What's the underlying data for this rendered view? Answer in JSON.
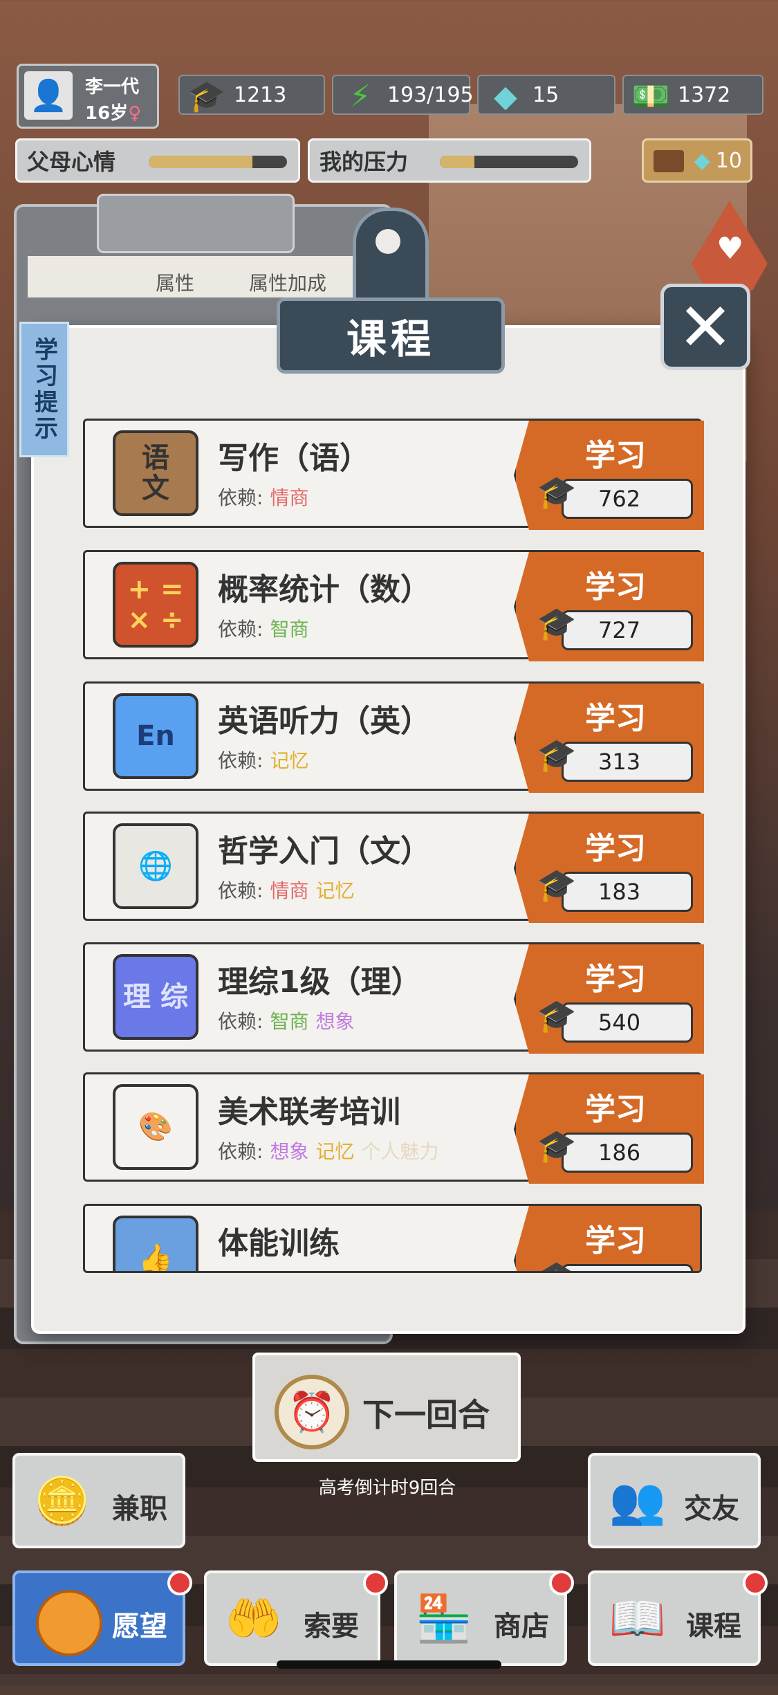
{
  "player": {
    "name": "李一代",
    "age": "16岁",
    "gender_symbol": "♀"
  },
  "stats": [
    {
      "icon": "graduation-cap-icon",
      "value": "1213"
    },
    {
      "icon": "lightning-icon",
      "value": "193/195"
    },
    {
      "icon": "diamond-icon",
      "value": "15"
    },
    {
      "icon": "money-icon",
      "value": "1372"
    }
  ],
  "moods": [
    {
      "label": "父母心情",
      "fill": 0.75
    },
    {
      "label": "我的压力",
      "fill": 0.25
    }
  ],
  "video_reward": {
    "value": "10"
  },
  "clipboard": {
    "col1": "属性",
    "col2": "属性加成",
    "tip_tab": "学习提示"
  },
  "panel": {
    "title": "课程"
  },
  "courses": [
    {
      "icon": "语\n文",
      "name": "写作（语）",
      "dep_label": "依赖:",
      "deps": [
        {
          "t": "情商",
          "c": "#e26a6a"
        }
      ],
      "btn": "学习",
      "cost": "762"
    },
    {
      "icon": "+ =\n× ÷",
      "name": "概率统计（数）",
      "dep_label": "依赖:",
      "deps": [
        {
          "t": "智商",
          "c": "#6db34f"
        }
      ],
      "btn": "学习",
      "cost": "727"
    },
    {
      "icon": "En",
      "name": "英语听力（英）",
      "dep_label": "依赖:",
      "deps": [
        {
          "t": "记忆",
          "c": "#e0b030"
        }
      ],
      "btn": "学习",
      "cost": "313"
    },
    {
      "icon": "🌐",
      "name": "哲学入门（文）",
      "dep_label": "依赖:",
      "deps": [
        {
          "t": "情商",
          "c": "#e26a6a"
        },
        {
          "t": "记忆",
          "c": "#e0b030"
        }
      ],
      "btn": "学习",
      "cost": "183"
    },
    {
      "icon": "理 综",
      "name": "理综1级（理）",
      "dep_label": "依赖:",
      "deps": [
        {
          "t": "智商",
          "c": "#6db34f"
        },
        {
          "t": "想象",
          "c": "#c07ae0"
        }
      ],
      "btn": "学习",
      "cost": "540"
    },
    {
      "icon": "🎨",
      "name": "美术联考培训",
      "dep_label": "依赖:",
      "deps": [
        {
          "t": "想象",
          "c": "#c07ae0"
        },
        {
          "t": "记忆",
          "c": "#e0b030"
        },
        {
          "t": "个人魅力",
          "c": "#e8d8c0"
        }
      ],
      "btn": "学习",
      "cost": "186"
    },
    {
      "icon": "👍",
      "name": "体能训练",
      "dep_label": "",
      "deps": [],
      "btn": "学习",
      "cost": ""
    }
  ],
  "bottom": {
    "next_round": "下一回合",
    "countdown": "高考倒计时9回合",
    "parttime": "兼职",
    "friends": "交友",
    "wish": "愿望",
    "ask": "索要",
    "shop": "商店",
    "course": "课程"
  }
}
